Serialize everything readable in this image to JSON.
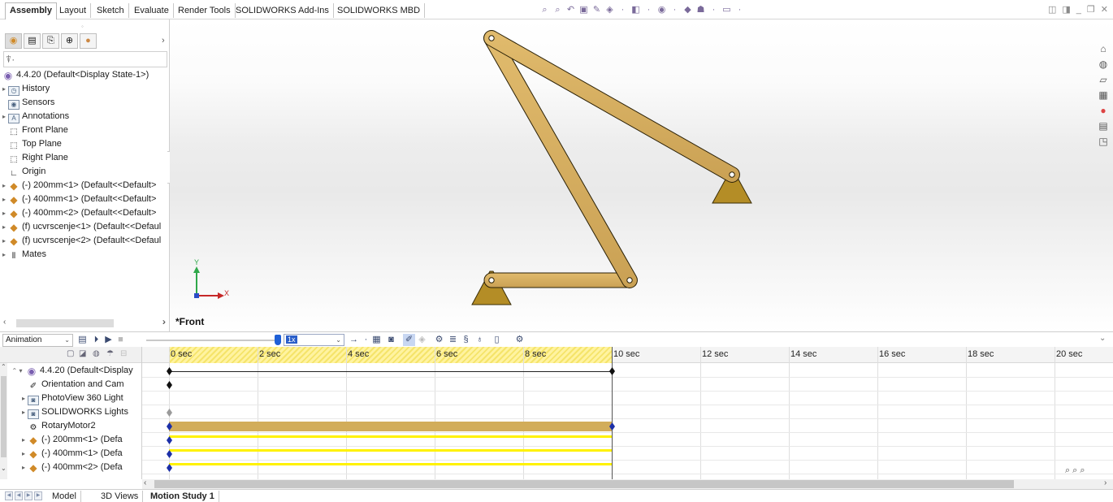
{
  "command_tabs": [
    "Assembly",
    "Layout",
    "Sketch",
    "Evaluate",
    "Render Tools",
    "SOLIDWORKS Add-Ins",
    "SOLIDWORKS MBD"
  ],
  "active_command_tab": "Assembly",
  "feature_tree": {
    "root": "4.4.20  (Default<Display State-1>)",
    "items": [
      {
        "label": "History",
        "icon": "history-icon",
        "expandable": true
      },
      {
        "label": "Sensors",
        "icon": "sensors-icon",
        "expandable": false
      },
      {
        "label": "Annotations",
        "icon": "annotations-icon",
        "expandable": true
      },
      {
        "label": "Front Plane",
        "icon": "plane-icon",
        "expandable": false
      },
      {
        "label": "Top Plane",
        "icon": "plane-icon",
        "expandable": false
      },
      {
        "label": "Right Plane",
        "icon": "plane-icon",
        "expandable": false
      },
      {
        "label": "Origin",
        "icon": "origin-icon",
        "expandable": false
      },
      {
        "label": "(-) 200mm<1> (Default<<Default>",
        "icon": "part-icon",
        "expandable": true
      },
      {
        "label": "(-) 400mm<1> (Default<<Default>",
        "icon": "part-icon",
        "expandable": true
      },
      {
        "label": "(-) 400mm<2> (Default<<Default>",
        "icon": "part-icon",
        "expandable": true
      },
      {
        "label": "(f) ucvrscenje<1> (Default<<Defaul",
        "icon": "part-icon",
        "expandable": true
      },
      {
        "label": "(f) ucvrscenje<2> (Default<<Defaul",
        "icon": "part-icon",
        "expandable": true
      },
      {
        "label": "Mates",
        "icon": "mates-icon",
        "expandable": true
      }
    ]
  },
  "viewport": {
    "view_name": "*Front",
    "triad_x": "X",
    "triad_y": "Y",
    "link_color": "#d6ac5e",
    "ground_color": "#b58e26"
  },
  "motion_study": {
    "study_type": "Animation",
    "playback_speed": "1x",
    "time_labels": [
      "0 sec",
      "2 sec",
      "4 sec",
      "6 sec",
      "8 sec",
      "10 sec",
      "12 sec",
      "14 sec",
      "16 sec",
      "18 sec",
      "20 sec"
    ],
    "tree_items": [
      {
        "label": "4.4.20  (Default<Display",
        "icon": "assembly-icon"
      },
      {
        "label": "Orientation and Cam",
        "icon": "camera-icon"
      },
      {
        "label": "PhotoView 360 Light",
        "icon": "light-icon"
      },
      {
        "label": "SOLIDWORKS Lights",
        "icon": "light-icon"
      },
      {
        "label": "RotaryMotor2",
        "icon": "motor-icon"
      },
      {
        "label": "(-) 200mm<1> (Defa",
        "icon": "part-icon"
      },
      {
        "label": "(-) 400mm<1> (Defa",
        "icon": "part-icon"
      },
      {
        "label": "(-) 400mm<2> (Defa",
        "icon": "part-icon"
      }
    ],
    "key_color": "#1c2fa8",
    "motor_bar_color": "#d2ad5a",
    "change_bar_color": "#fff200"
  },
  "bottom_tabs": [
    "Model",
    "3D Views",
    "Motion Study 1"
  ],
  "active_bottom_tab": "Motion Study 1"
}
